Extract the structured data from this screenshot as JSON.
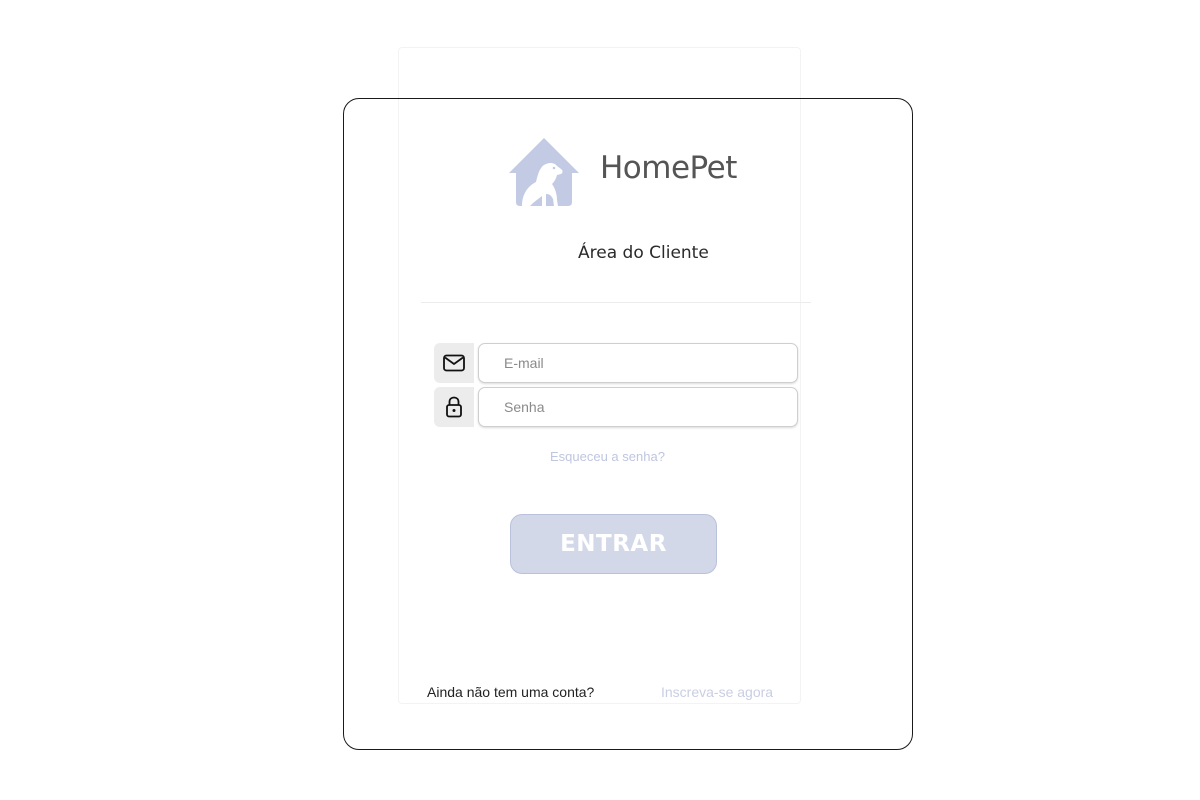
{
  "brand": {
    "name": "HomePet",
    "icon": "house-with-dog-icon",
    "icon_color": "#c3cae3"
  },
  "login": {
    "subtitle": "Área do Cliente",
    "email_placeholder": "E-mail",
    "email_icon": "envelope-icon",
    "password_placeholder": "Senha",
    "password_icon": "lock-icon",
    "forgot_password": "Esqueceu a senha?",
    "submit_label": "ENTRAR"
  },
  "footer": {
    "prompt": "Ainda não tem uma conta?",
    "signup_link": "Inscreva-se agora"
  },
  "colors": {
    "accent": "#c3cae3",
    "button_bg": "#d3d8e8",
    "link": "#bfc6e0"
  }
}
